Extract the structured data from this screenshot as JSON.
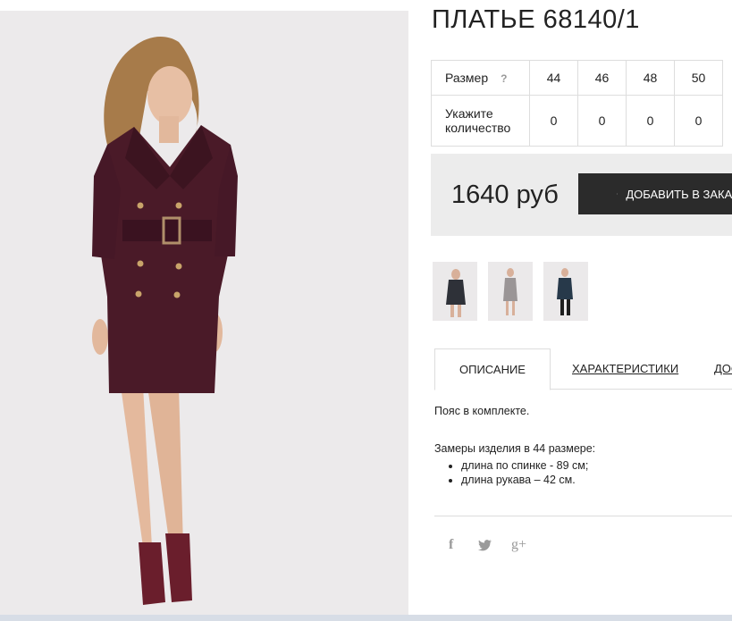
{
  "product": {
    "title": "ПЛАТЬЕ 68140/1",
    "image_alt": "model in burgundy belted double-breasted dress"
  },
  "sizes": {
    "size_label": "Размер",
    "help": "?",
    "qty_label": "Укажите количество",
    "options": [
      {
        "size": "44",
        "qty": "0"
      },
      {
        "size": "46",
        "qty": "0"
      },
      {
        "size": "48",
        "qty": "0"
      },
      {
        "size": "50",
        "qty": "0"
      }
    ]
  },
  "purchase": {
    "price": "1640 руб",
    "add_button": "ДОБАВИТЬ В ЗАКАЗ"
  },
  "tabs": {
    "description": "ОПИСАНИЕ",
    "specs": "ХАРАКТЕРИСТИКИ",
    "delivery": "ДОСТАВКА"
  },
  "description": {
    "line1": "Пояс в комплекте.",
    "line2": "Замеры изделия в 44 размере:",
    "items": [
      "длина по спинке - 89 см;",
      "длина рукава – 42 см."
    ]
  },
  "social": {
    "facebook": "f",
    "twitter": "twitter-icon",
    "gplus": "g+"
  },
  "colors": {
    "dress": "#4a1a28",
    "button_bg": "#2b2b2b",
    "price_bg": "#ececec"
  }
}
